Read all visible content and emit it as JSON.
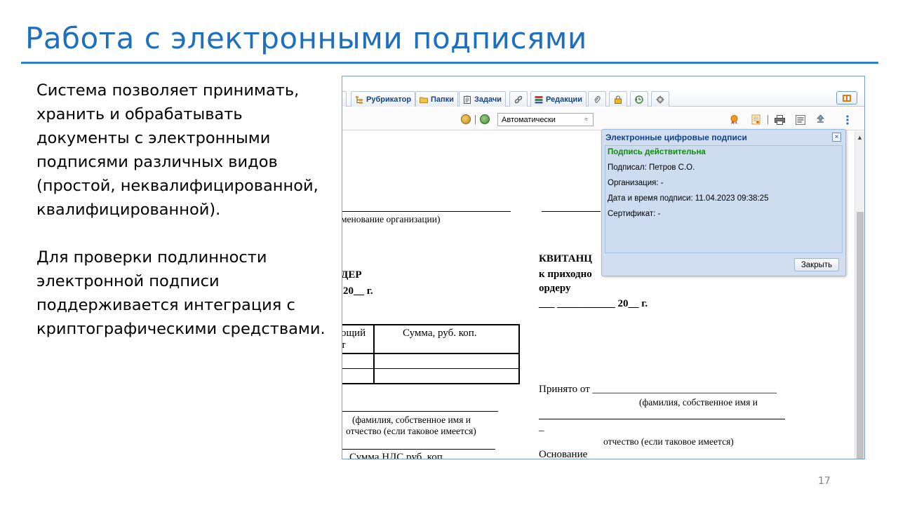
{
  "slide": {
    "title": "Работа с электронными подписями",
    "paragraph1": [
      "Система позволяет принимать,",
      "хранить и обрабатывать",
      "документы с электронными",
      "подписями различных видов",
      "(простой, неквалифицированной,",
      "квалифицированной)."
    ],
    "paragraph2": [
      "Для проверки подлинности",
      "электронной подписи",
      "поддерживается интеграция с",
      "криптографическими средствами."
    ],
    "page_number": "17"
  },
  "app": {
    "tabs": {
      "rubricator": "Рубрикатор",
      "folders": "Папки",
      "tasks": "Задачи",
      "editions": "Редакции"
    },
    "viewer": {
      "zoom_value": "Автоматически",
      "zoom_arrow": "÷"
    },
    "document": {
      "org_caption": "менование организации)",
      "order_title": "ДЕР",
      "order_date": "20__ г.",
      "receipt_title": "КВИТАНЦ",
      "receipt_sub1": "к приходно",
      "receipt_sub2": "ордеру",
      "receipt_date": "___ ___________ 20__ г.",
      "table_col1_line1": "ощий",
      "table_col1_line2": "т",
      "table_col2": "Сумма, руб. коп.",
      "fio_caption_line1": "(фамилия, собственное имя и",
      "fio_caption_line2": "отчество (если таковое имеется)",
      "vat": "Сумма НДС       руб.       коп.",
      "received_from": "Принято от ___________________________________",
      "received_caption1": "(фамилия, собственное имя и",
      "received_underscore": "_",
      "received_caption2": "отчество (если таковое имеется)",
      "basis": "Основание"
    },
    "signature_panel": {
      "title": "Электронные цифровые подписи",
      "close_glyph": "×",
      "status": "Подпись действительна",
      "signed_by": "Подписал: Петров С.О.",
      "organization": "Организация: -",
      "datetime": "Дата и время подписи: 11.04.2023 09:38:25",
      "certificate": "Сертификат: -",
      "close_button": "Закрыть"
    }
  },
  "colors": {
    "title_blue": "#1f6fbf",
    "panel_title": "#15428b",
    "valid_green": "#128a12",
    "panel_bg": "#d0def0"
  }
}
